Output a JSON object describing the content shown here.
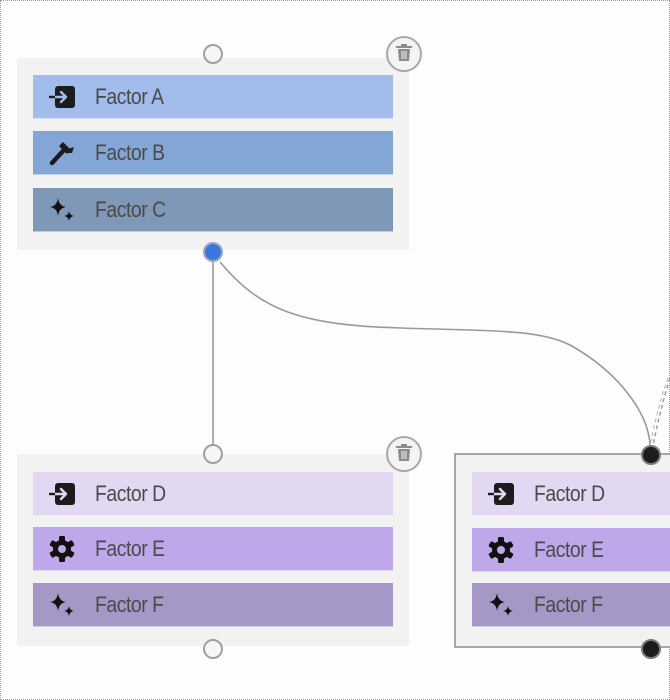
{
  "nodes": [
    {
      "id": "node-1",
      "rows": [
        {
          "label": "Factor A",
          "icon": "login-icon",
          "color": "#a2bdeb"
        },
        {
          "label": "Factor B",
          "icon": "hammer-icon",
          "color": "#84a6d6"
        },
        {
          "label": "Factor C",
          "icon": "sparkles-icon",
          "color": "#7f98b8"
        }
      ],
      "delete_icon": "trash-icon"
    },
    {
      "id": "node-2",
      "rows": [
        {
          "label": "Factor D",
          "icon": "login-icon",
          "color": "#e2d8f2"
        },
        {
          "label": "Factor E",
          "icon": "gear-icon",
          "color": "#bea8ea"
        },
        {
          "label": "Factor F",
          "icon": "sparkles-icon",
          "color": "#a698c6"
        }
      ],
      "delete_icon": "trash-icon"
    },
    {
      "id": "node-3",
      "selected": true,
      "rows": [
        {
          "label": "Factor D",
          "icon": "login-icon",
          "color": "#e2d8f2"
        },
        {
          "label": "Factor E",
          "icon": "gear-icon",
          "color": "#bea8ea"
        },
        {
          "label": "Factor F",
          "icon": "sparkles-icon",
          "color": "#a698c6"
        }
      ]
    }
  ],
  "edges": [
    {
      "from": "node-1",
      "to": "node-2",
      "style": "solid"
    },
    {
      "from": "node-1",
      "to": "node-3",
      "style": "solid"
    },
    {
      "from": "offscreen",
      "to": "node-3",
      "style": "dashed"
    }
  ],
  "colors": {
    "active_handle": "#3a78de",
    "edge": "#9a9a9a",
    "node_bg": "#f2f2f2"
  }
}
